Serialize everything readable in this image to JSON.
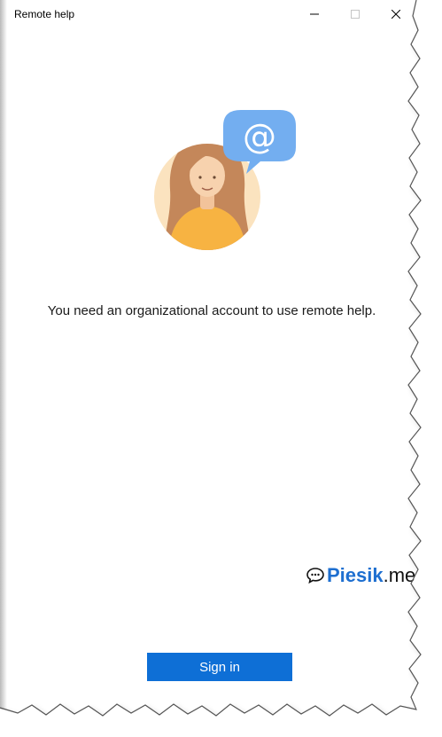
{
  "window": {
    "title": "Remote help"
  },
  "main": {
    "message": "You need an organizational account to use remote help.",
    "illustration_badge": "@",
    "sign_in_label": "Sign in"
  },
  "watermark": {
    "word": "Piesik",
    "tld": ".me"
  },
  "colors": {
    "accent": "#0e6fd6",
    "bubble": "#73aef0",
    "shirt": "#f7b342",
    "watermark_blue": "#1e6fd0"
  },
  "icons": [
    "minimize-icon",
    "maximize-icon",
    "close-icon",
    "avatar-illustration",
    "at-sign-icon",
    "speech-bubble-icon"
  ]
}
